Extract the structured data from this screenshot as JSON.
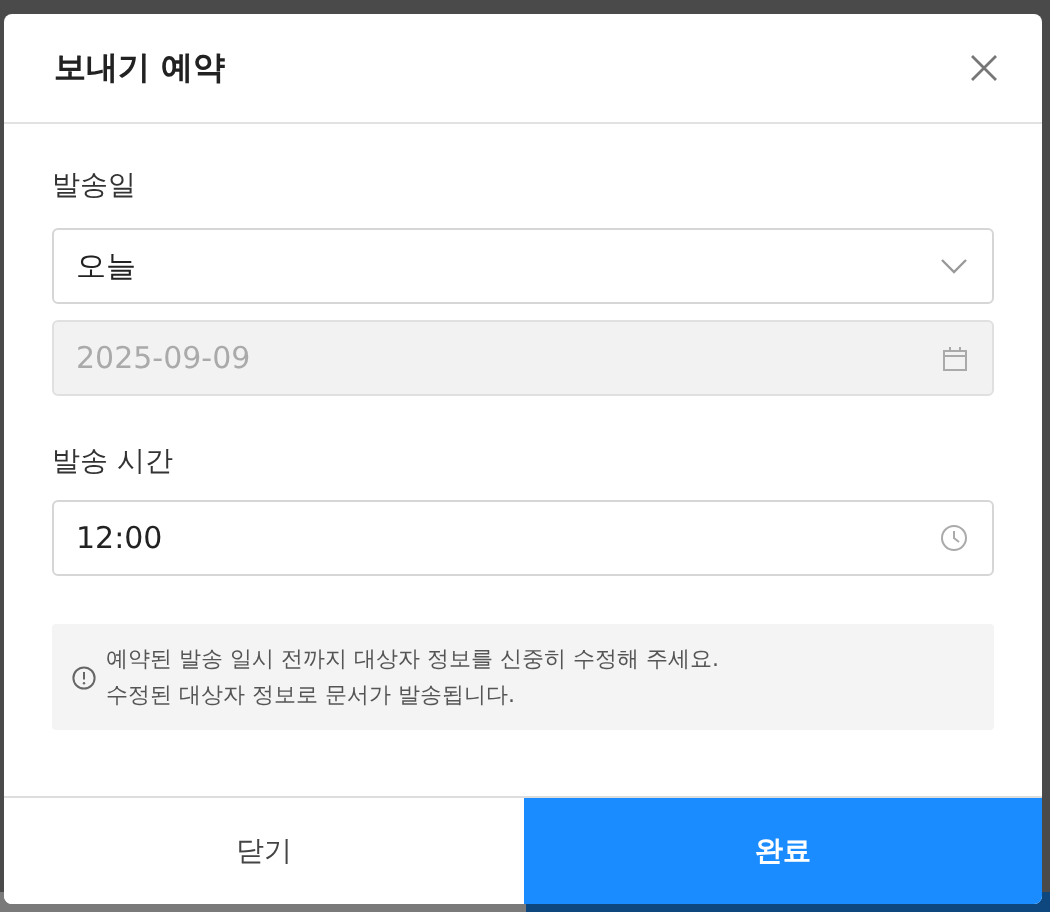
{
  "dialog": {
    "title": "보내기 예약"
  },
  "date_section": {
    "label": "발송일",
    "select": {
      "value": "오늘"
    },
    "date_field": {
      "value": "2025-09-09",
      "disabled": true
    }
  },
  "time_section": {
    "label": "발송 시간",
    "time_field": {
      "value": "12:00",
      "disabled": false
    }
  },
  "notice": [
    "예약된 발송 일시 전까지 대상자 정보를 신중히 수정해 주세요.",
    "수정된 대상자 정보로 문서가 발송됩니다."
  ],
  "buttons": [
    {
      "label": "닫기",
      "kind": "secondary"
    },
    {
      "label": "완료",
      "kind": "primary"
    }
  ]
}
